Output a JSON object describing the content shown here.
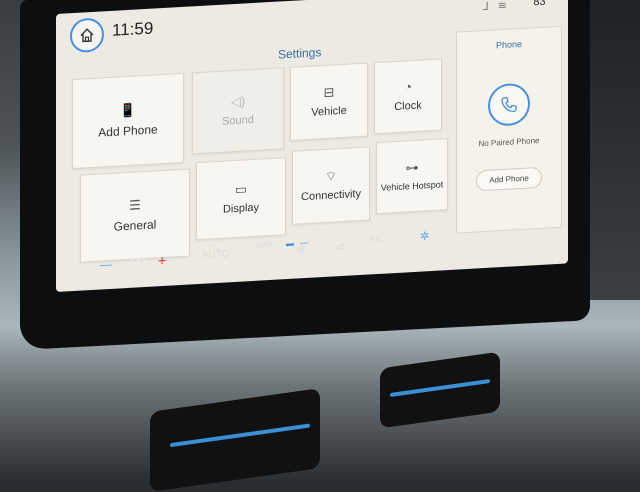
{
  "status_bar": {
    "time": "11:59",
    "status_icons": "⅃ ≋",
    "outside_temp": "83°"
  },
  "settings": {
    "title": "Settings",
    "tiles": [
      {
        "label": "Add Phone",
        "icon": "phone-add-icon"
      },
      {
        "label": "Sound",
        "icon": "speaker-icon"
      },
      {
        "label": "Vehicle",
        "icon": "vehicle-icon"
      },
      {
        "label": "Clock",
        "icon": "clock-icon"
      },
      {
        "label": "General",
        "icon": "sliders-icon"
      },
      {
        "label": "Display",
        "icon": "display-icon"
      },
      {
        "label": "Connectivity",
        "icon": "wifi-icon"
      },
      {
        "label": "Vehicle Hotspot",
        "icon": "hotspot-car-icon"
      }
    ]
  },
  "phone_panel": {
    "title": "Phone",
    "status": "No Paired Phone",
    "button": "Add Phone"
  },
  "climate": {
    "minus": "—",
    "fan_level": "LO",
    "plus": "+",
    "auto": "AUTO",
    "max": "MAX",
    "ac": "A/C"
  },
  "colors": {
    "accent": "#4a90e2",
    "screen_bg": "#eceae3",
    "tile_bg": "#f7f6f1",
    "plus_red": "#e2352b"
  }
}
